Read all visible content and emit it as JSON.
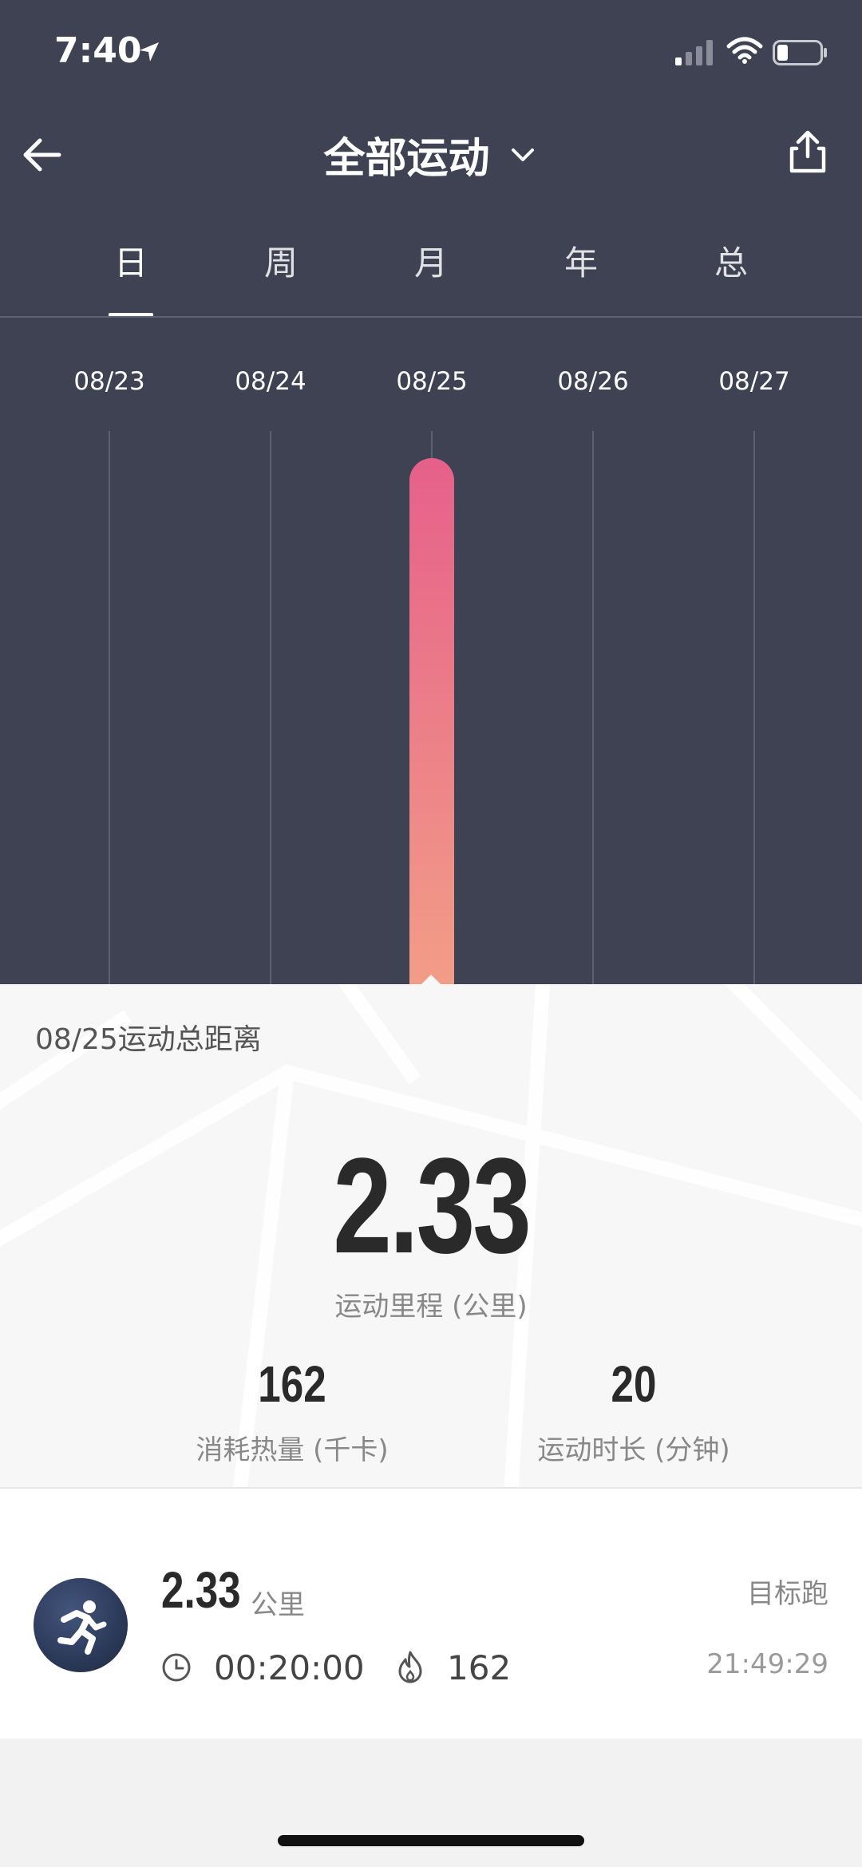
{
  "status_bar": {
    "time": "7:40"
  },
  "header": {
    "title": "全部运动"
  },
  "tabs": [
    {
      "label": "日"
    },
    {
      "label": "周"
    },
    {
      "label": "月"
    },
    {
      "label": "年"
    },
    {
      "label": "总"
    }
  ],
  "chart_data": {
    "type": "bar",
    "categories": [
      "08/23",
      "08/24",
      "08/25",
      "08/26",
      "08/27"
    ],
    "values": [
      0,
      0,
      2.33,
      0,
      0
    ],
    "selected_category": "08/25",
    "grid": true,
    "bar_gradient": [
      "#e6608a",
      "#f3a087"
    ]
  },
  "summary": {
    "title": "08/25运动总距离",
    "distance": "2.33",
    "distance_label": "运动里程 (公里)",
    "calories": "162",
    "calories_label": "消耗热量 (千卡)",
    "duration": "20",
    "duration_label": "运动时长 (分钟)"
  },
  "record": {
    "distance": "2.33",
    "unit": "公里",
    "type": "目标跑",
    "duration": "00:20:00",
    "calories": "162",
    "time": "21:49:29"
  },
  "colors": {
    "header_bg": "#3f4252",
    "accent_bar_top": "#e6608a",
    "accent_bar_bottom": "#f3a087"
  }
}
